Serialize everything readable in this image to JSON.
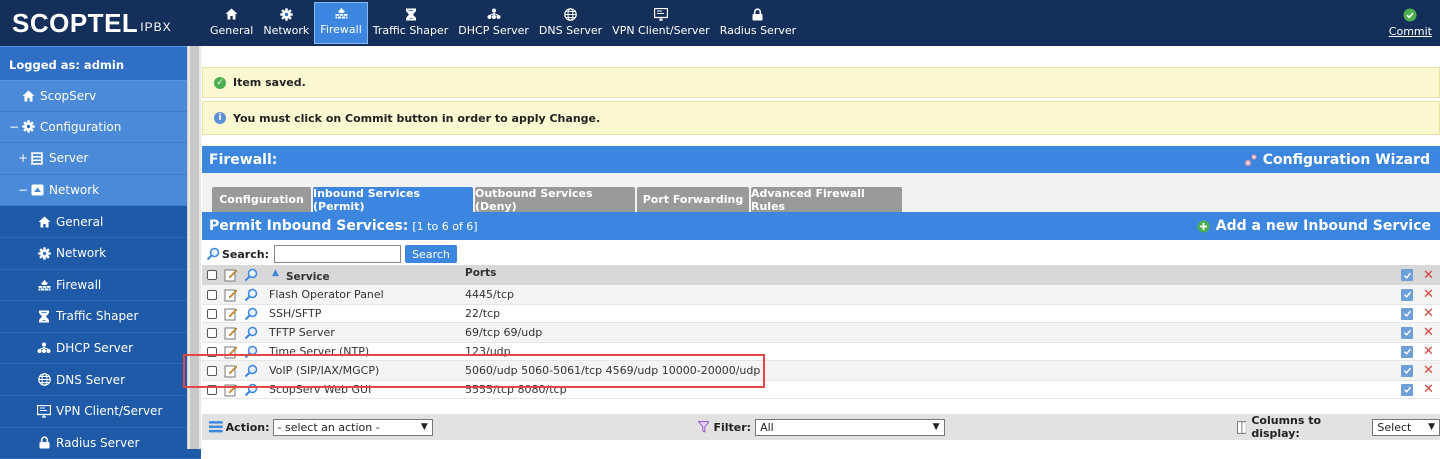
{
  "logo": {
    "brand": "SCOPTEL",
    "suffix": "IPBX"
  },
  "sidebar": {
    "logged_as": "Logged as: admin",
    "items": [
      {
        "label": "ScopServ",
        "toggle": "",
        "icon": "home-icon"
      },
      {
        "label": "Configuration",
        "toggle": "−",
        "icon": "gear-icon"
      },
      {
        "label": "Server",
        "toggle": "+",
        "icon": "server-icon"
      },
      {
        "label": "Network",
        "toggle": "−",
        "icon": "network-icon"
      },
      {
        "label": "General",
        "icon": "home-icon"
      },
      {
        "label": "Network",
        "icon": "gear-icon"
      },
      {
        "label": "Firewall",
        "icon": "firewall-icon"
      },
      {
        "label": "Traffic Shaper",
        "icon": "shaper-icon"
      },
      {
        "label": "DHCP Server",
        "icon": "dhcp-icon"
      },
      {
        "label": "DNS Server",
        "icon": "globe-icon"
      },
      {
        "label": "VPN Client/Server",
        "icon": "monitor-icon"
      },
      {
        "label": "Radius Server",
        "icon": "lock-icon"
      }
    ]
  },
  "topnav": {
    "tabs": [
      {
        "label": "General",
        "icon": "home-icon"
      },
      {
        "label": "Network",
        "icon": "gear-icon"
      },
      {
        "label": "Firewall",
        "icon": "firewall-icon"
      },
      {
        "label": "Traffic Shaper",
        "icon": "shaper-icon"
      },
      {
        "label": "DHCP Server",
        "icon": "dhcp-icon"
      },
      {
        "label": "DNS Server",
        "icon": "globe-icon"
      },
      {
        "label": "VPN Client/Server",
        "icon": "monitor-icon"
      },
      {
        "label": "Radius Server",
        "icon": "lock-icon"
      }
    ],
    "active": "Firewall",
    "commit_label": "Commit"
  },
  "messages": {
    "saved": "Item saved.",
    "commit_notice": "You must click on Commit button in order to apply Change."
  },
  "header": {
    "title": "Firewall:",
    "wizard_label": "Configuration Wizard"
  },
  "tabs": [
    {
      "label": "Configuration"
    },
    {
      "label": "Inbound Services (Permit)"
    },
    {
      "label": "Outbound Services (Deny)"
    },
    {
      "label": "Port Forwarding"
    },
    {
      "label": "Advanced Firewall Rules"
    }
  ],
  "panel": {
    "title": "Permit Inbound Services:",
    "count": "[1 to 6 of 6]",
    "add_label": "Add a new Inbound Service"
  },
  "search": {
    "label": "Search:",
    "value": "",
    "button_label": "Search"
  },
  "table": {
    "columns": [
      "Service",
      "Ports"
    ],
    "rows": [
      {
        "service": "Flash Operator Panel",
        "ports": "4445/tcp"
      },
      {
        "service": "SSH/SFTP",
        "ports": "22/tcp"
      },
      {
        "service": "TFTP Server",
        "ports": "69/tcp 69/udp"
      },
      {
        "service": "Time Server (NTP)",
        "ports": "123/udp"
      },
      {
        "service": "VoIP (SIP/IAX/MGCP)",
        "ports": "5060/udp 5060-5061/tcp 4569/udp 10000-20000/udp"
      },
      {
        "service": "ScopServ Web GUI",
        "ports": "5555/tcp 8080/tcp"
      }
    ]
  },
  "footer": {
    "action_label": "Action:",
    "action_value": "- select an action -",
    "filter_label": "Filter:",
    "filter_value": "All",
    "columns_label": "Columns to display:",
    "columns_value": "Select"
  },
  "colors": {
    "nav_dark": "#14305a",
    "accent_blue": "#3d86e0",
    "sidebar_blue": "#4a8ad8",
    "notice_yellow": "#fcf9d2",
    "delete_red": "#d9443a",
    "highlight_red": "#e04848"
  }
}
